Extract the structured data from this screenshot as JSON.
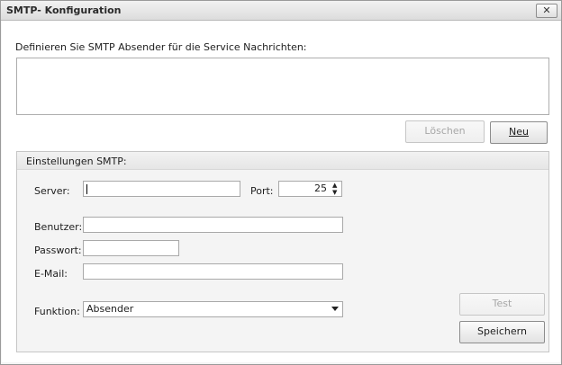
{
  "window": {
    "title": "SMTP- Konfiguration",
    "close_symbol": "✕"
  },
  "intro_label": "Definieren Sie SMTP Absender für die Service Nachrichten:",
  "buttons": {
    "delete": "Löschen",
    "new": "Neu",
    "test": "Test",
    "save": "Speichern"
  },
  "group": {
    "title": "Einstellungen SMTP:",
    "server_label": "Server:",
    "server_value": "",
    "port_label": "Port:",
    "port_value": "25",
    "user_label": "Benutzer:",
    "user_value": "",
    "password_label": "Passwort:",
    "password_value": "",
    "email_label": "E-Mail:",
    "email_value": "",
    "function_label": "Funktion:",
    "function_value": "Absender"
  },
  "icons": {
    "close": "close-icon",
    "spin_up": "arrow-up-icon",
    "spin_down": "arrow-down-icon",
    "dropdown": "chevron-down-icon"
  }
}
